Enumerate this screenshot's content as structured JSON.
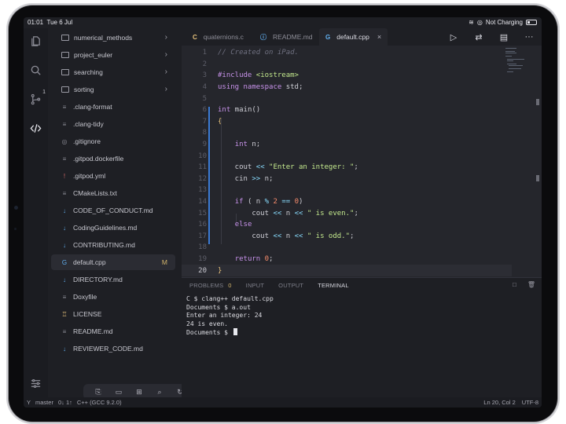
{
  "status_bar": {
    "time": "01:01",
    "date": "Tue 6 Jul",
    "charging": "Not Charging"
  },
  "activity_bar": [
    "explorer-icon",
    "search-icon",
    "source-control-icon",
    "code-icon",
    "settings-icon"
  ],
  "source_control_badge": "1",
  "sidebar": {
    "items": [
      {
        "label": "numerical_methods",
        "type": "folder",
        "chevron": "›"
      },
      {
        "label": "project_euler",
        "type": "folder",
        "chevron": "›"
      },
      {
        "label": "searching",
        "type": "folder",
        "chevron": "›"
      },
      {
        "label": "sorting",
        "type": "folder",
        "chevron": "›"
      },
      {
        "label": ".clang-format",
        "type": "file",
        "icon": "≡"
      },
      {
        "label": ".clang-tidy",
        "type": "file",
        "icon": "≡"
      },
      {
        "label": ".gitignore",
        "type": "file",
        "icon": "◎"
      },
      {
        "label": ".gitpod.dockerfile",
        "type": "file",
        "icon": "≡"
      },
      {
        "label": ".gitpod.yml",
        "type": "file",
        "icon": "!"
      },
      {
        "label": "CMakeLists.txt",
        "type": "file",
        "icon": "≡"
      },
      {
        "label": "CODE_OF_CONDUCT.md",
        "type": "file",
        "icon": "↓"
      },
      {
        "label": "CodingGuidelines.md",
        "type": "file",
        "icon": "↓"
      },
      {
        "label": "CONTRIBUTING.md",
        "type": "file",
        "icon": "↓"
      },
      {
        "label": "default.cpp",
        "type": "file",
        "icon": "G",
        "selected": true,
        "modified": "M"
      },
      {
        "label": "DIRECTORY.md",
        "type": "file",
        "icon": "↓"
      },
      {
        "label": "Doxyfile",
        "type": "file",
        "icon": "≡"
      },
      {
        "label": "LICENSE",
        "type": "file",
        "icon": "♖"
      },
      {
        "label": "README.md",
        "type": "file",
        "icon": "≡"
      },
      {
        "label": "REVIEWER_CODE.md",
        "type": "file",
        "icon": "↓"
      }
    ],
    "toolbar": [
      "new-file-icon",
      "new-folder-icon",
      "import-icon",
      "search-icon",
      "refresh-icon"
    ]
  },
  "tabs": [
    {
      "label": "quaternions.c",
      "icon": "C",
      "color": "#e5c07b"
    },
    {
      "label": "README.md",
      "icon": "ⓘ",
      "color": "#61afef"
    },
    {
      "label": "default.cpp",
      "icon": "G",
      "color": "#61afef",
      "active": true,
      "close": "×"
    }
  ],
  "editor_actions": [
    "run-icon",
    "compare-icon",
    "preview-icon",
    "more-icon"
  ],
  "editor": {
    "line_numbers": [
      "1",
      "2",
      "3",
      "4",
      "5",
      "6",
      "7",
      "8",
      "9",
      "10",
      "11",
      "12",
      "13",
      "14",
      "15",
      "16",
      "17",
      "18",
      "19",
      "20"
    ],
    "lines": [
      "// Created on iPad.",
      "",
      "#include <iostream>",
      "using namespace std;",
      "",
      "int main()",
      "{",
      "",
      "    int n;",
      "",
      "    cout << \"Enter an integer: \";",
      "    cin >> n;",
      "",
      "    if ( n % 2 == 0)",
      "        cout << n << \" is even.\";",
      "    else",
      "        cout << n << \" is odd.\";",
      "",
      "    return 0;",
      "}"
    ],
    "current_line": 20
  },
  "panel": {
    "tabs": [
      "PROBLEMS",
      "INPUT",
      "OUTPUT",
      "TERMINAL"
    ],
    "problems_count": "0",
    "active_tab": "TERMINAL",
    "terminal_lines": [
      "C $ clang++ default.cpp",
      "Documents $ a.out",
      "Enter an integer: 24",
      "24 is even.",
      "Documents $ "
    ]
  },
  "footer": {
    "branch": "master",
    "sync": "0↓ 1↑",
    "language": "C++ (GCC 9.2.0)",
    "position": "Ln 20, Col 2",
    "encoding": "UTF-8"
  }
}
